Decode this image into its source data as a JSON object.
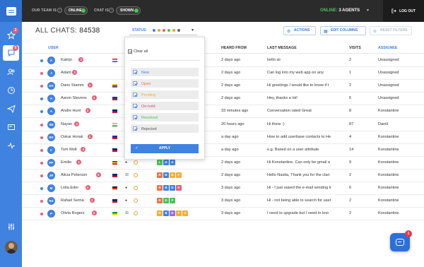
{
  "colors": {
    "accent": "#3f82e0",
    "online": "#4cc05a",
    "badge": "#e85d75",
    "topbar": "#2b2b2b"
  },
  "sidebar": {
    "logo_icon": "chat-bubble-icon",
    "items": [
      {
        "name": "starred",
        "icon": "star-icon",
        "badge": "2"
      },
      {
        "name": "chats",
        "icon": "chat-icon",
        "badge": "6",
        "active": true
      },
      {
        "name": "users",
        "icon": "users-icon"
      },
      {
        "name": "history",
        "icon": "clock-icon"
      },
      {
        "name": "messages",
        "icon": "send-icon"
      },
      {
        "name": "canned",
        "icon": "card-icon"
      },
      {
        "name": "analytics",
        "icon": "pulse-icon"
      },
      {
        "name": "settings",
        "icon": "sliders-icon"
      }
    ]
  },
  "topbar": {
    "team_label": "OUR TEAM IS",
    "team_status": "ONLINE",
    "chat_label": "CHAT IS",
    "chat_status": "SHOWN",
    "help_glyph": "?",
    "agents_status": "ONLINE:",
    "agents_count": "3 AGENTS",
    "logout": "LOG OUT"
  },
  "header": {
    "title": "ALL CHATS:",
    "count": "84538",
    "actions": "ACTIONS",
    "edit_columns": "EDIT COLUMNS",
    "reset_filters": "RESET FILTERS"
  },
  "status_filter": {
    "label": "STATUS:",
    "dot_colors": [
      "#3f82e0",
      "#e8a33a",
      "#e85d75",
      "#4cc05a",
      "#f0a020",
      "#666666"
    ],
    "clear_all": "Clear all",
    "options": [
      {
        "label": "New",
        "color": "#3f82e0"
      },
      {
        "label": "Open",
        "color": "#e8744a"
      },
      {
        "label": "Pending",
        "color": "#f0b030"
      },
      {
        "label": "On-hold",
        "color": "#d04a7a"
      },
      {
        "label": "Resolved",
        "color": "#4cc05a"
      },
      {
        "label": "Rejected",
        "color": "#555555"
      }
    ],
    "apply": "APPLY"
  },
  "table": {
    "columns": {
      "user": "USER",
      "heard": "HEARD FROM",
      "last": "LAST MESSAGE",
      "visits": "VISITS",
      "assignee": "ASSIGNEE"
    },
    "rows": [
      {
        "initials": "A",
        "name": "Katrijn",
        "badge": "2",
        "dot": "#3f82e0",
        "flag": "nl",
        "heard": "2 days ago",
        "last": "hello sir",
        "visits": "2",
        "assignee": "Unassigned"
      },
      {
        "initials": "J",
        "name": "Adam",
        "badge": "2",
        "dot": "#e85d75",
        "flag": "",
        "heard": "2 days ago",
        "last": "Can log into my web app on any",
        "visits": "1",
        "assignee": "Unassigned"
      },
      {
        "initials": "DS",
        "name": "Dario Stamm",
        "badge": "1",
        "dot": "#e85d75",
        "flag": "ec",
        "heard": "2 days ago",
        "last": "Hi greetings I would like to know if t",
        "visits": "2",
        "assignee": "Unassigned"
      },
      {
        "initials": "A",
        "name": "Aaron Stevens",
        "badge": "1",
        "dot": "#3f82e0",
        "flag": "ph",
        "heard": "2 days ago",
        "last": "Hey, thanks a lot!",
        "visits": "6",
        "assignee": "Unassigned"
      },
      {
        "initials": "A",
        "name": "Andre Hunt",
        "badge": "2",
        "dot": "#3f82e0",
        "flag": "gb",
        "heard": "33 minutes ago",
        "last": "Conversation rated Great",
        "visits": "8",
        "assignee": "Konstantine"
      },
      {
        "initials": "SB",
        "name": "Nayan",
        "badge": "2",
        "dot": "#e85d75",
        "flag": "in",
        "heard": "20 hours ago",
        "last": "Hi there :)",
        "visits": "87",
        "assignee": "Daniil"
      },
      {
        "initials": "BS",
        "name": "Oskar Horak",
        "badge": "2",
        "dot": "#e85d75",
        "flag": "ph",
        "heard": "a day ago",
        "last": "How to add userbase contacts to He",
        "visits": "4",
        "assignee": "Konstantine"
      },
      {
        "initials": "C",
        "name": "Tom Molt",
        "badge": "2",
        "dot": "#e85d75",
        "flag": "nz",
        "os": "",
        "heard": "a day ago",
        "last": "e.g. Based on a user attribute",
        "visits": "14",
        "assignee": "Konstantine",
        "tags": [
          [
            "#e8744a",
            "R"
          ],
          [
            "#4cc05a",
            "E"
          ],
          [
            "#4cc05a",
            "F"
          ]
        ]
      },
      {
        "initials": "PP",
        "name": "Emilio",
        "badge": "1",
        "dot": "#e85d75",
        "flag": "es",
        "os": "",
        "heard": "2 days ago",
        "last": "Hi Konstantine. Can only be gmail a",
        "visits": "9",
        "assignee": "Konstantine",
        "tags": [
          [
            "#4cc05a",
            "L"
          ],
          [
            "#3f82e0",
            "D"
          ],
          [
            "#3f82e0",
            "D"
          ]
        ]
      },
      {
        "initials": "JR",
        "name": "Alicia Peterson",
        "badge": "2",
        "dot": "#e85d75",
        "flag": "gb",
        "os": "⊞",
        "heard": "2 days ago",
        "last": "Hello Nastia, Thank you for the clari",
        "visits": "2",
        "assignee": "Konstantine",
        "tags": [
          [
            "#e8744a",
            "R"
          ],
          [
            "#3f82e0",
            "B"
          ],
          [
            "#f0b030",
            "D"
          ],
          [
            "#f0b030",
            "F"
          ]
        ]
      },
      {
        "initials": "M",
        "name": "Lidia Eder",
        "badge": "1",
        "dot": "#3f82e0",
        "flag": "de",
        "os": "",
        "heard": "3 days ago",
        "last": "Hi - I just raised the e-mail sending li",
        "visits": "6",
        "assignee": "Konstantine",
        "tags": [
          [
            "#e8744a",
            "R"
          ],
          [
            "#3f82e0",
            "B"
          ],
          [
            "#3f82e0",
            "D"
          ],
          [
            "#e85d75",
            "E"
          ]
        ]
      },
      {
        "initials": "RS",
        "name": "Rafael Serna",
        "badge": "2",
        "dot": "#e85d75",
        "flag": "gb",
        "os": "",
        "heard": "3 days ago",
        "last": "Hi - not being able to search for user",
        "visits": "2",
        "assignee": "Konstantine",
        "tags": [
          [
            "#e8744a",
            "R"
          ],
          [
            "#4cc05a",
            "E"
          ],
          [
            "#4cc05a",
            "F"
          ]
        ]
      },
      {
        "initials": "P",
        "name": "Olivia Rogers",
        "badge": "2",
        "dot": "#e85d75",
        "flag": "br",
        "os": "⊞",
        "heard": "3 days ago",
        "last": "I need to upgrade but I need to kno",
        "visits": "2",
        "assignee": "Konstantine",
        "tags": [
          [
            "#f0b030",
            "R"
          ],
          [
            "#3f82e0",
            "B"
          ],
          [
            "#9a6ae0",
            "D"
          ],
          [
            "#f0b030",
            "F"
          ],
          [
            "#f0b030",
            "G"
          ]
        ]
      }
    ]
  },
  "chat_widget": {
    "icon": "chat-icon",
    "badge": "1"
  }
}
